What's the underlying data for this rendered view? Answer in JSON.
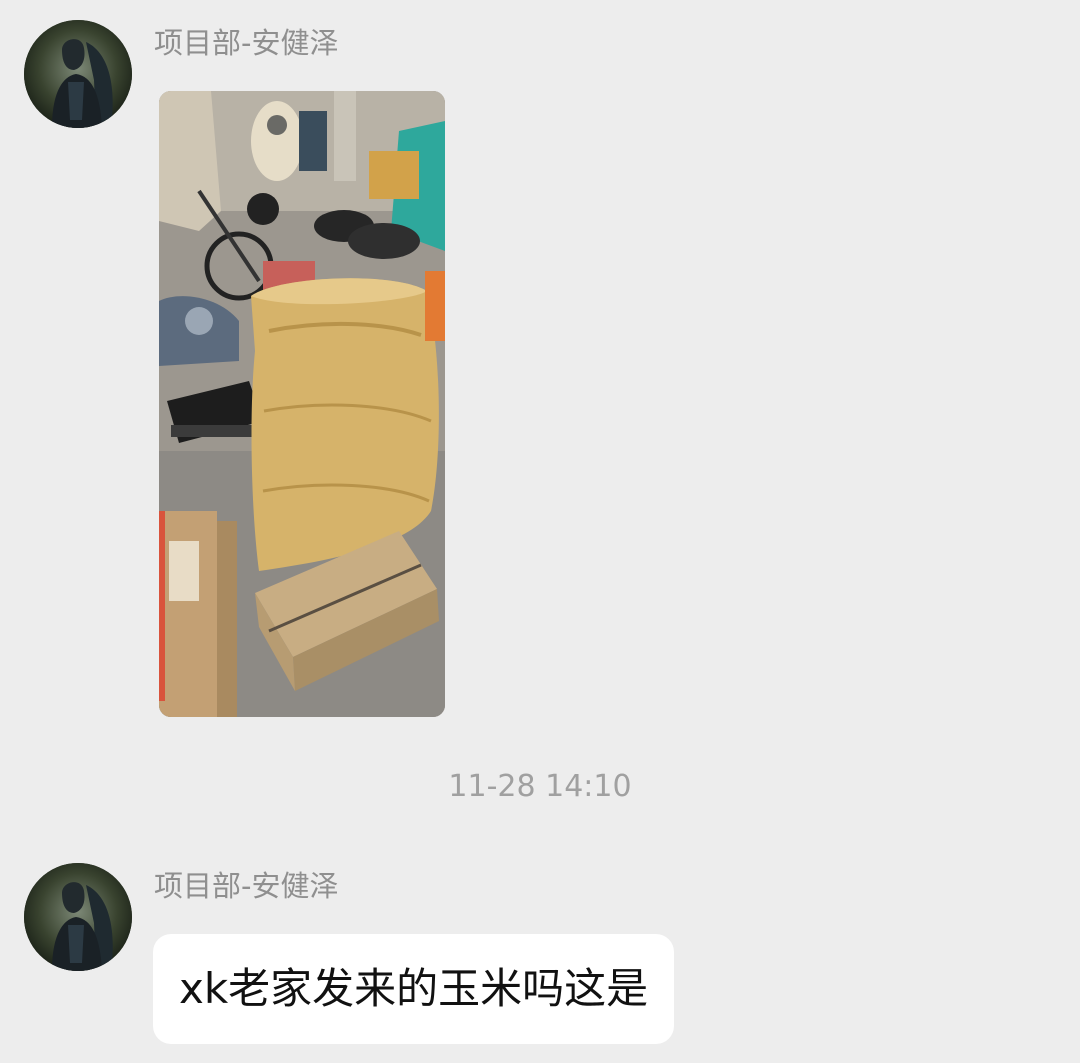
{
  "messages": [
    {
      "type": "image",
      "sender": "项目部-安健泽",
      "avatar_icon": "armored-hero-avatar",
      "image_subject": "photo"
    },
    {
      "type": "timestamp",
      "text": "11-28 14:10"
    },
    {
      "type": "text",
      "sender": "项目部-安健泽",
      "avatar_icon": "armored-hero-avatar",
      "text": "xk老家发来的玉米吗这是"
    }
  ],
  "colors": {
    "background": "#ededed",
    "bubble": "#ffffff",
    "sender_name": "#8f8f8f",
    "timestamp": "#a0a0a0",
    "message_text": "#111111"
  }
}
